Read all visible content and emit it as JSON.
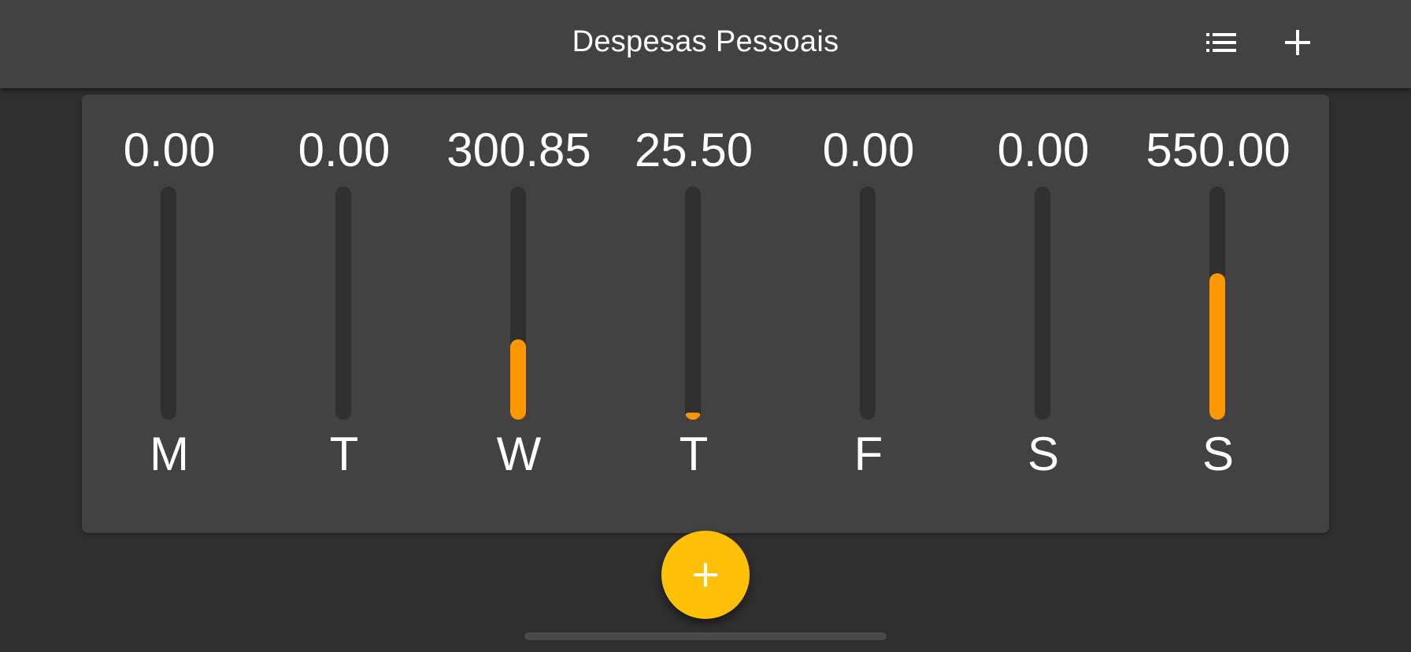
{
  "appbar": {
    "title": "Despesas Pessoais",
    "actions": [
      {
        "icon": "list-icon"
      },
      {
        "icon": "add-icon"
      }
    ]
  },
  "colors": {
    "background": "#2f2f2f",
    "surface": "#424242",
    "bar_track": "#303030",
    "bar_fill": "#ff9800",
    "fab": "#ffc107"
  },
  "chart_data": {
    "type": "bar",
    "categories": [
      "M",
      "T",
      "W",
      "T",
      "F",
      "S",
      "S"
    ],
    "values": [
      0.0,
      0.0,
      300.85,
      25.5,
      0.0,
      0.0,
      550.0
    ],
    "value_labels": [
      "0.00",
      "0.00",
      "300.85",
      "25.50",
      "0.00",
      "0.00",
      "550.00"
    ],
    "fill_fractions": [
      0.0,
      0.0,
      0.3433,
      0.0291,
      0.0,
      0.0,
      0.6276
    ]
  },
  "fab": {
    "icon": "add-icon"
  }
}
